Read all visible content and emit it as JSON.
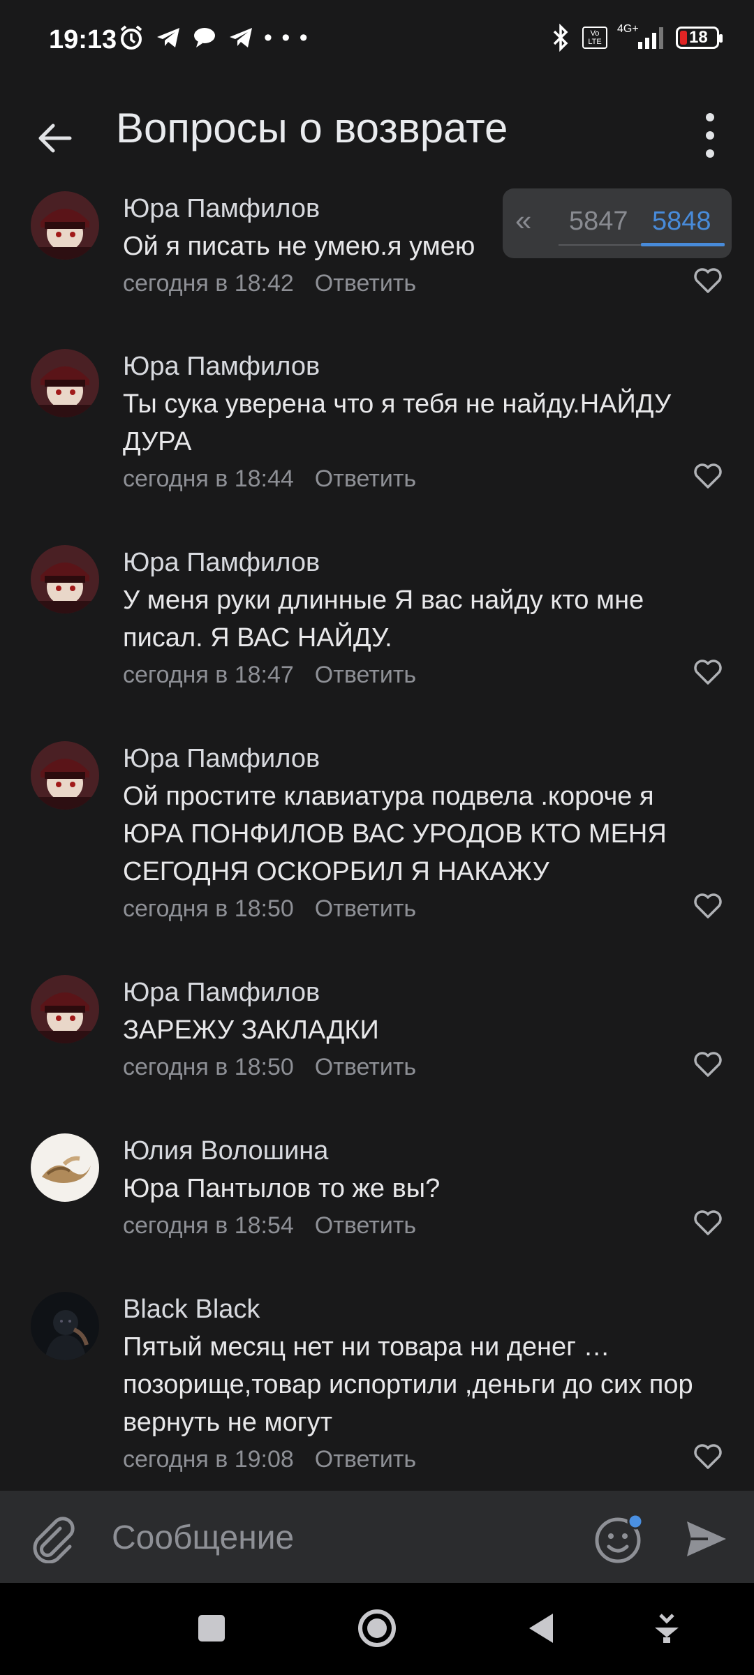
{
  "status_bar": {
    "time": "19:13",
    "volte": "Vo LTE",
    "network": "4G+",
    "battery": "18"
  },
  "header": {
    "title": "Вопросы о возврате"
  },
  "pager": {
    "back_symbol": "«",
    "pages": [
      "5847",
      "5848"
    ],
    "active_page": "5848"
  },
  "comments": [
    {
      "author": "Юра Памфилов",
      "text": "Ой я писать не умею.я умею ",
      "time": "сегодня в 18:42",
      "reply_label": "Ответить"
    },
    {
      "author": "Юра Памфилов",
      "text": "Ты сука уверена что я тебя не найду.НАЙДУ ДУРА",
      "time": "сегодня в 18:44",
      "reply_label": "Ответить"
    },
    {
      "author": "Юра Памфилов",
      "text": "У меня руки длинные Я вас найду кто мне писал. Я ВАС НАЙДУ.",
      "time": "сегодня в 18:47",
      "reply_label": "Ответить"
    },
    {
      "author": "Юра Памфилов",
      "text": "Ой простите клавиатура  подвела .короче я ЮРА ПОНФИЛОВ  ВАС УРОДОВ КТО МЕНЯ СЕГОДНЯ ОСКОРБИЛ Я НАКАЖУ",
      "time": "сегодня в 18:50",
      "reply_label": "Ответить"
    },
    {
      "author": "Юра Памфилов",
      "text": "ЗАРЕЖУ ЗАКЛАДКИ",
      "time": "сегодня в 18:50",
      "reply_label": "Ответить"
    },
    {
      "author": "Юлия Волошина",
      "text": "Юра Пантылов то же вы?",
      "time": "сегодня в 18:54",
      "reply_label": "Ответить"
    },
    {
      "author": "Black Black",
      "text": "Пятый месяц нет ни товара ни денег … позорище,товар испортили ,деньги до сих пор вернуть не могут",
      "time": "сегодня в 19:08",
      "reply_label": "Ответить"
    }
  ],
  "composer": {
    "placeholder": "Сообщение"
  },
  "colors": {
    "background": "#19191a",
    "accent": "#4a90e2",
    "muted_text": "#8e9096",
    "composer_bg": "#2b2c2e"
  },
  "icons": [
    "back-arrow-icon",
    "more-vertical-icon",
    "heart-icon",
    "paperclip-icon",
    "emoji-icon",
    "send-icon",
    "square-nav-icon",
    "home-circle-nav-icon",
    "back-triangle-nav-icon",
    "download-nav-icon"
  ]
}
